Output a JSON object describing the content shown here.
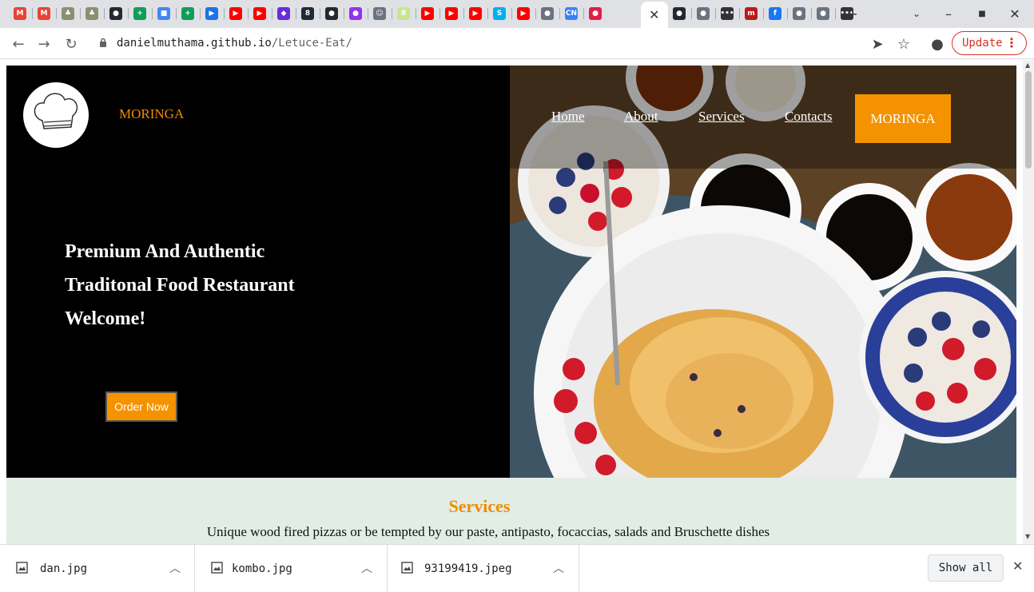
{
  "browser": {
    "tabs": [
      {
        "icon": "gmail-icon",
        "glyph": "M",
        "color": "#ea4335"
      },
      {
        "icon": "gmail-icon",
        "glyph": "M",
        "color": "#ea4335"
      },
      {
        "icon": "tree-icon",
        "glyph": "♣",
        "color": "#8b8f70"
      },
      {
        "icon": "tree-icon",
        "glyph": "♣",
        "color": "#8b8f70"
      },
      {
        "icon": "github-icon",
        "glyph": "●",
        "color": "#24292f"
      },
      {
        "icon": "sheets-icon",
        "glyph": "+",
        "color": "#0f9d58"
      },
      {
        "icon": "colorful-app-icon",
        "glyph": "■",
        "color": "#4285f4"
      },
      {
        "icon": "sheets-icon",
        "glyph": "+",
        "color": "#0f9d58"
      },
      {
        "icon": "video-player-icon",
        "glyph": "▶",
        "color": "#1a73e8"
      },
      {
        "icon": "youtube-icon",
        "glyph": "▶",
        "color": "#ff0000"
      },
      {
        "icon": "youtube-icon",
        "glyph": "▶",
        "color": "#ff0000"
      },
      {
        "icon": "purple-diamond-icon",
        "glyph": "◆",
        "color": "#6c2bd9"
      },
      {
        "icon": "hexagon-icon",
        "glyph": "8",
        "color": "#1f2937"
      },
      {
        "icon": "github-icon",
        "glyph": "●",
        "color": "#24292f"
      },
      {
        "icon": "location-pin-icon",
        "glyph": "●",
        "color": "#9333ea"
      },
      {
        "icon": "avatar-icon",
        "glyph": "☺",
        "color": "#6b7280"
      },
      {
        "icon": "green-circle-icon",
        "glyph": "8",
        "color": "#c7e58f"
      },
      {
        "icon": "youtube-icon",
        "glyph": "▶",
        "color": "#ff0000"
      },
      {
        "icon": "youtube-icon",
        "glyph": "▶",
        "color": "#ff0000"
      },
      {
        "icon": "youtube-icon",
        "glyph": "▶",
        "color": "#ff0000"
      },
      {
        "icon": "skype-icon",
        "glyph": "S",
        "color": "#00aff0"
      },
      {
        "icon": "youtube-icon",
        "glyph": "▶",
        "color": "#ff0000"
      },
      {
        "icon": "globe-icon",
        "glyph": "●",
        "color": "#6b7280"
      },
      {
        "icon": "cn-icon",
        "glyph": "CN",
        "color": "#3b82f6"
      },
      {
        "icon": "red-circle-icon",
        "glyph": "●",
        "color": "#e11d48"
      },
      {
        "icon": "github-icon",
        "glyph": "●",
        "color": "#24292f"
      },
      {
        "icon": "globe-icon",
        "glyph": "●",
        "color": "#6b7280"
      },
      {
        "icon": "dots-icon",
        "glyph": "•••",
        "color": "#333333"
      },
      {
        "icon": "m-logo-icon",
        "glyph": "m",
        "color": "#b91c1c"
      },
      {
        "icon": "facebook-icon",
        "glyph": "f",
        "color": "#1877f2"
      },
      {
        "icon": "globe-icon",
        "glyph": "●",
        "color": "#6b7280"
      },
      {
        "icon": "chrome-icon",
        "glyph": "●",
        "color": "#6b7280"
      },
      {
        "icon": "dots-icon",
        "glyph": "•••",
        "color": "#333333"
      }
    ],
    "url_host": "danielmuthama.github.io",
    "url_path": "/Letuce-Eat/",
    "update_label": "Update"
  },
  "site": {
    "brand": "MORINGA",
    "nav": [
      "Home",
      "About",
      "Services",
      "Contacts"
    ],
    "nav_cta": "MORINGA",
    "headline": [
      "Premium And Authentic",
      "Traditonal Food Restaurant",
      "Welcome!"
    ],
    "order_button": "Order Now",
    "services_title": "Services",
    "services_text": "Unique wood fired pizzas or be tempted by our paste, antipasto, focaccias, salads and Bruschette dishes"
  },
  "downloads": {
    "files": [
      "dan.jpg",
      "kombo.jpg",
      "93199419.jpeg"
    ],
    "show_all": "Show all"
  },
  "colors": {
    "accent": "#f59200",
    "services_bg": "#e2ede6",
    "update_red": "#d93025"
  }
}
